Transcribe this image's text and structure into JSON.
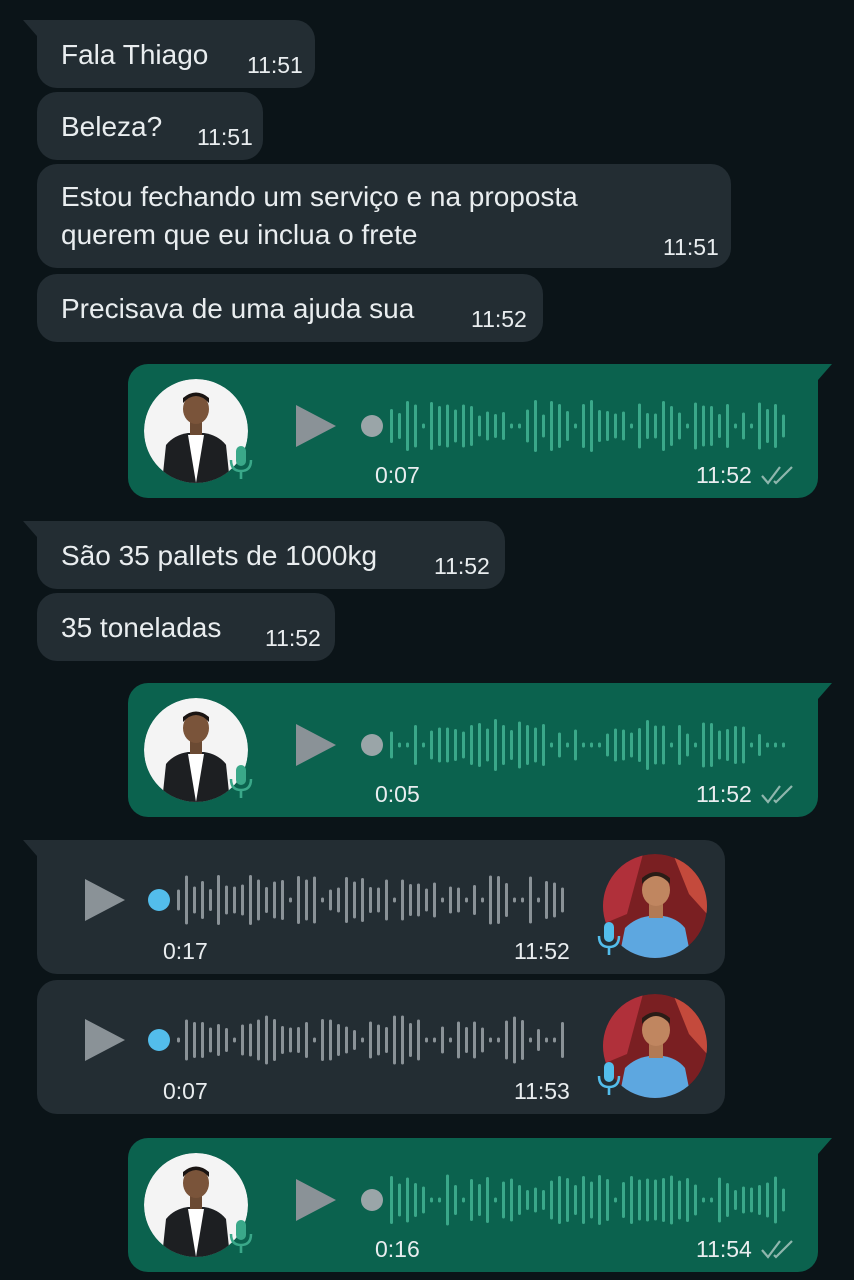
{
  "messages": [
    {
      "text": "Fala Thiago",
      "time": "11:51"
    },
    {
      "text": "Beleza?",
      "time": "11:51"
    },
    {
      "line1": "Estou fechando um serviço e na proposta",
      "line2": "querem que eu inclua o frete",
      "time": "11:51"
    },
    {
      "text": "Precisava de uma ajuda sua",
      "time": "11:52"
    },
    {
      "type": "voice-out",
      "duration": "0:07",
      "time": "11:52",
      "status": "read"
    },
    {
      "text": "São 35 pallets de 1000kg",
      "time": "11:52"
    },
    {
      "text": "35 toneladas",
      "time": "11:52"
    },
    {
      "type": "voice-out",
      "duration": "0:05",
      "time": "11:52",
      "status": "read"
    },
    {
      "type": "voice-in",
      "duration": "0:17",
      "time": "11:52"
    },
    {
      "type": "voice-in",
      "duration": "0:07",
      "time": "11:53"
    },
    {
      "type": "voice-out",
      "duration": "0:16",
      "time": "11:54",
      "status": "read"
    }
  ],
  "colors": {
    "background": "#0b1418",
    "incoming_bubble": "#232d33",
    "outgoing_bubble": "#0b624e",
    "waveform_incoming": "#8a9297",
    "waveform_outgoing": "#3aa889",
    "progress_dot_incoming": "#53bdeb",
    "mic_incoming": "#53bdeb",
    "mic_outgoing": "#3aa889"
  },
  "icons": {
    "play": "play-icon",
    "mic": "microphone-icon",
    "read": "double-check-icon"
  }
}
